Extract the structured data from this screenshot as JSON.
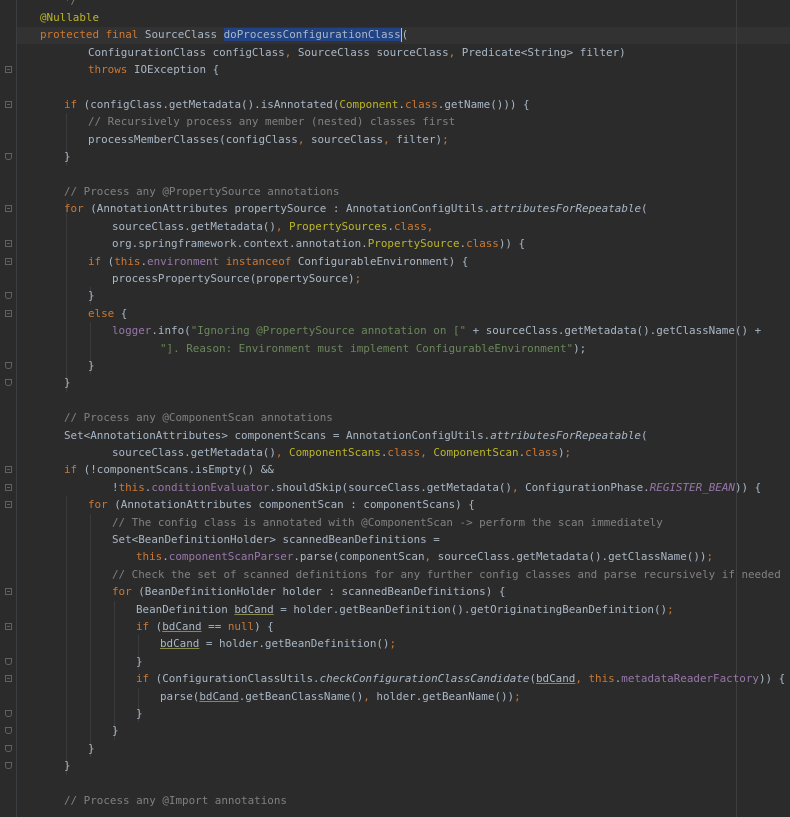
{
  "editor": {
    "language": "Java",
    "selected_identifier": "doProcessConfigurationClass",
    "colors": {
      "background": "#2b2b2b",
      "keyword": "#cc7832",
      "annotation": "#bbb529",
      "comment": "#808080",
      "string": "#6a8759",
      "field": "#9876aa",
      "default_text": "#a9b7c6",
      "selection": "#214283"
    }
  },
  "code_lines": [
    [
      "*/"
    ],
    [
      "@Nullable"
    ],
    [
      "protected",
      " ",
      "final",
      " SourceClass ",
      "doProcessConfigurationClass",
      "("
    ],
    [
      "ConfigurationClass configClass",
      ",",
      " SourceClass sourceClass",
      ",",
      " Predicate<String> filter)"
    ],
    [
      "throws",
      " IOException {"
    ],
    [],
    [
      "if",
      " (configClass.getMetadata().isAnnotated(",
      "Component",
      ".",
      "class",
      ".getName())) {"
    ],
    [
      "// Recursively process any member (nested) classes first"
    ],
    [
      "processMemberClasses(configClass",
      ",",
      " sourceClass",
      ",",
      " filter)",
      ";"
    ],
    [
      "}"
    ],
    [],
    [
      "// Process any @PropertySource annotations"
    ],
    [
      "for",
      " (AnnotationAttributes propertySource : AnnotationConfigUtils.",
      "attributesForRepeatable",
      "("
    ],
    [
      "sourceClass.getMetadata()",
      ",",
      " ",
      "PropertySources",
      ".",
      "class",
      ","
    ],
    [
      "org.springframework.context.annotation.",
      "PropertySource",
      ".",
      "class",
      ")) {"
    ],
    [
      "if",
      " (",
      "this",
      ".",
      "environment",
      " ",
      "instanceof",
      " ConfigurableEnvironment) {"
    ],
    [
      "processPropertySource(propertySource)",
      ";"
    ],
    [
      "}"
    ],
    [
      "else",
      " {"
    ],
    [
      "logger",
      ".info(",
      "\"Ignoring @PropertySource annotation on [\"",
      " + sourceClass.getMetadata().getClassName() +"
    ],
    [
      "\"]. Reason: Environment must implement ConfigurableEnvironment\"",
      ");"
    ],
    [
      "}"
    ],
    [
      "}"
    ],
    [],
    [
      "// Process any @ComponentScan annotations"
    ],
    [
      "Set<AnnotationAttributes> componentScans = AnnotationConfigUtils.",
      "attributesForRepeatable",
      "("
    ],
    [
      "sourceClass.getMetadata()",
      ",",
      " ",
      "ComponentScans",
      ".",
      "class",
      ",",
      " ",
      "ComponentScan",
      ".",
      "class",
      ")",
      ";"
    ],
    [
      "if",
      " (!componentScans.isEmpty() &&"
    ],
    [
      "!",
      "this",
      ".",
      "conditionEvaluator",
      ".shouldSkip(sourceClass.getMetadata()",
      ",",
      " ConfigurationPhase.",
      "REGISTER_BEAN",
      ")) {"
    ],
    [
      "for",
      " (AnnotationAttributes componentScan : componentScans) {"
    ],
    [
      "// The config class is annotated with @ComponentScan -> perform the scan immediately"
    ],
    [
      "Set<BeanDefinitionHolder> scannedBeanDefinitions ="
    ],
    [
      "this",
      ".",
      "componentScanParser",
      ".parse(componentScan",
      ",",
      " sourceClass.getMetadata().getClassName())",
      ";"
    ],
    [
      "// Check the set of scanned definitions for any further config classes and parse recursively if needed"
    ],
    [
      "for",
      " (BeanDefinitionHolder holder : scannedBeanDefinitions) {"
    ],
    [
      "BeanDefinition ",
      "bdCand",
      " = holder.getBeanDefinition().getOriginatingBeanDefinition()",
      ";"
    ],
    [
      "if",
      " (",
      "bdCand",
      " == ",
      "null",
      ") {"
    ],
    [
      "bdCand",
      " = holder.getBeanDefinition()",
      ";"
    ],
    [
      "}"
    ],
    [
      "if",
      " (ConfigurationClassUtils.",
      "checkConfigurationClassCandidate",
      "(",
      "bdCand",
      ",",
      " ",
      "this",
      ".",
      "metadataReaderFactory",
      ")) {"
    ],
    [
      "parse(",
      "bdCand",
      ".getBeanClassName()",
      ",",
      " holder.getBeanName())",
      ";"
    ],
    [
      "}"
    ],
    [
      "}"
    ],
    [
      "}"
    ],
    [
      "}"
    ],
    [],
    [
      "// Process any @Import annotations"
    ]
  ]
}
